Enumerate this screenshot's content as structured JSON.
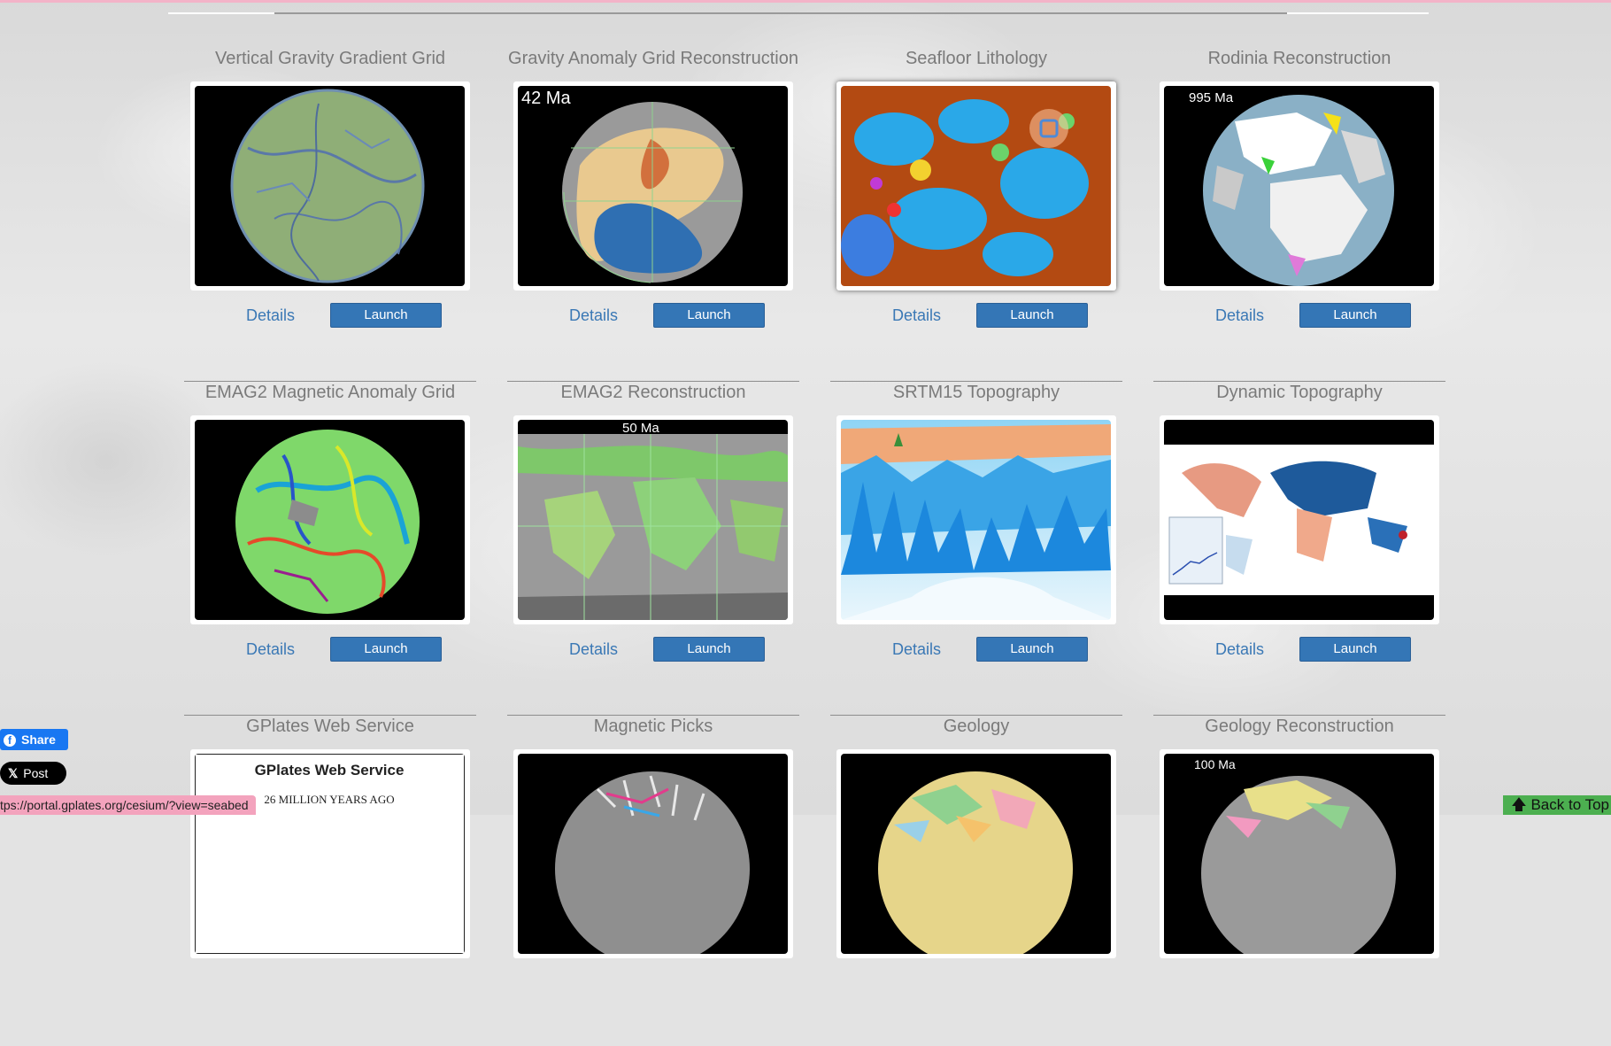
{
  "cards": [
    {
      "title": "Vertical Gravity Gradient Grid",
      "details": "Details",
      "launch": "Launch"
    },
    {
      "title": "Gravity Anomaly Grid Reconstruction",
      "details": "Details",
      "launch": "Launch",
      "overlay": "42 Ma"
    },
    {
      "title": "Seafloor Lithology",
      "details": "Details",
      "launch": "Launch"
    },
    {
      "title": "Rodinia Reconstruction",
      "details": "Details",
      "launch": "Launch",
      "overlay": "995 Ma"
    },
    {
      "title": "EMAG2 Magnetic Anomaly Grid",
      "details": "Details",
      "launch": "Launch"
    },
    {
      "title": "EMAG2 Reconstruction",
      "details": "Details",
      "launch": "Launch",
      "overlay": "50 Ma"
    },
    {
      "title": "SRTM15 Topography",
      "details": "Details",
      "launch": "Launch"
    },
    {
      "title": "Dynamic Topography",
      "details": "Details",
      "launch": "Launch"
    },
    {
      "title": "GPlates Web Service",
      "thumb_heading": "GPlates Web Service",
      "thumb_caption": "26 MILLION YEARS AGO"
    },
    {
      "title": "Magnetic Picks"
    },
    {
      "title": "Geology"
    },
    {
      "title": "Geology Reconstruction",
      "overlay": "100 Ma"
    }
  ],
  "social": {
    "share": "Share",
    "post": "Post"
  },
  "status_url": "tps://portal.gplates.org/cesium/?view=seabed",
  "back_to_top": "Back to Top",
  "colors": {
    "link": "#3a78b5",
    "button": "#3476b6",
    "title": "#7a7a7a"
  }
}
